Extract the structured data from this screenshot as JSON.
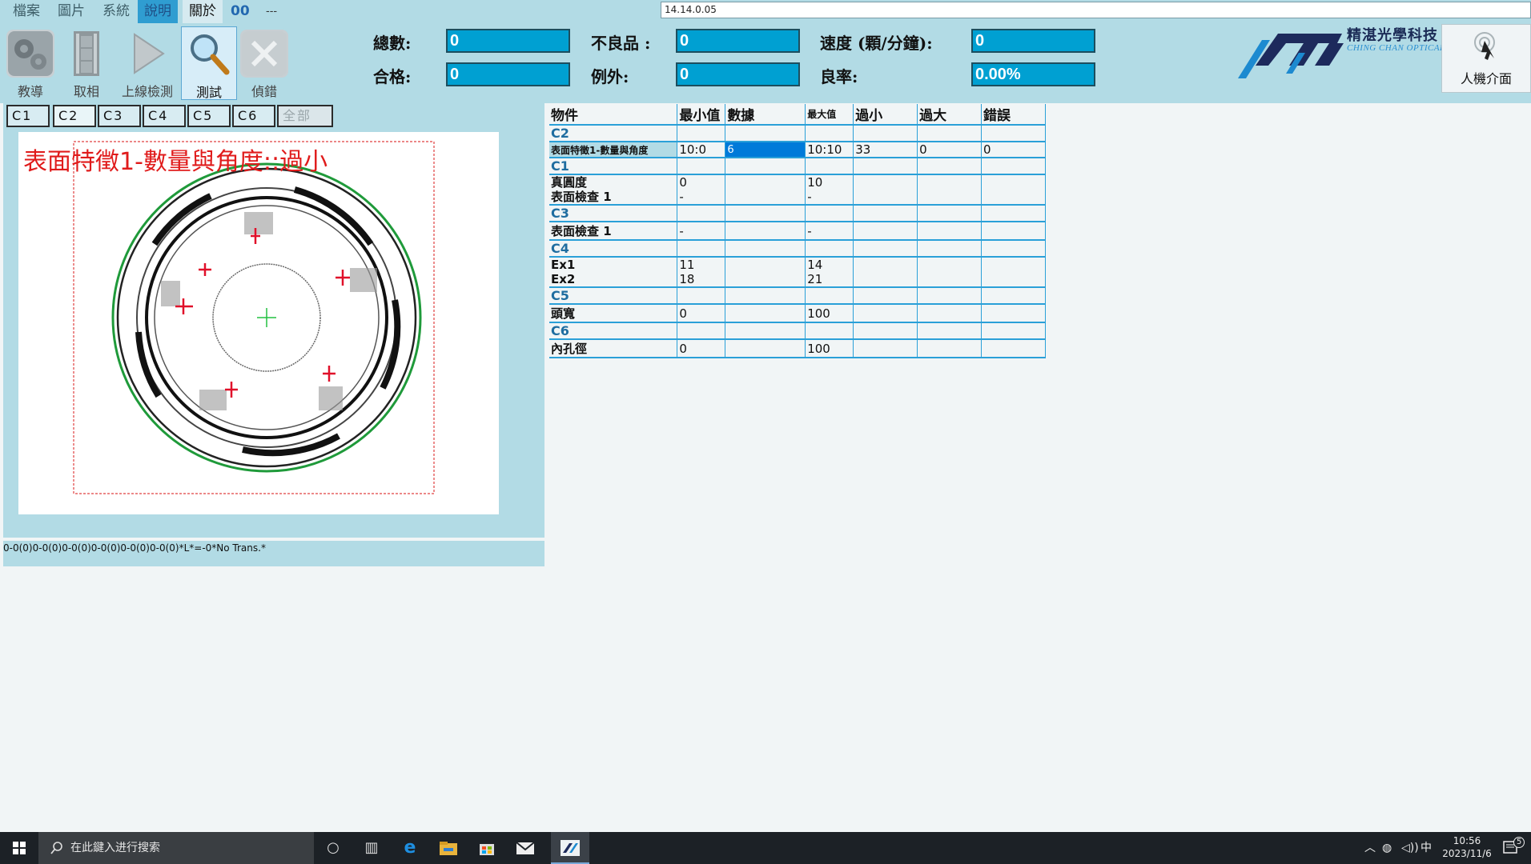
{
  "menu": {
    "items": [
      "檔案",
      "圖片",
      "系統",
      "說明",
      "關於"
    ],
    "counter": "00",
    "dash": "---",
    "version": "14.14.0.05"
  },
  "toolbar": {
    "tools": [
      {
        "label": "教導",
        "icon": "gears-icon"
      },
      {
        "label": "取相",
        "icon": "film-icon"
      },
      {
        "label": "上線檢測",
        "icon": "play-icon"
      },
      {
        "label": "測試",
        "icon": "magnifier-icon"
      },
      {
        "label": "偵錯",
        "icon": "tools-icon"
      }
    ],
    "selected_index": 3
  },
  "stats": {
    "total_label": "總數:",
    "total_value": "0",
    "pass_label": "合格:",
    "pass_value": "0",
    "defect_label": "不良品 :",
    "defect_value": "0",
    "exception_label": "例外:",
    "exception_value": "0",
    "speed_label": "速度 (顆/分鐘):",
    "speed_value": "0",
    "yield_label": "良率:",
    "yield_value": "0.00%"
  },
  "logo": {
    "cn": "精湛光學科技",
    "en": "CHING CHAN OPTICAL"
  },
  "hmi": {
    "label": "人機介面"
  },
  "camera_tabs": [
    "C1",
    "C2",
    "C3",
    "C4",
    "C5",
    "C6",
    "全部"
  ],
  "image_overlay": "表面特徵1-數量與角度::過小",
  "status_text": "0-0(0)0-0(0)0-0(0)0-0(0)0-0(0)0-0(0)*L*=-0*No Trans.*",
  "table": {
    "headers": [
      "物件",
      "最小值",
      "數據",
      "最大值",
      "過小",
      "過大",
      "錯誤"
    ],
    "groups": [
      {
        "name": "C2",
        "rows": [
          {
            "name": "表面特徵1-數量與角度",
            "min": "10:0",
            "data": "6",
            "max": "10:10",
            "under": "33",
            "over": "0",
            "error": "0"
          }
        ]
      },
      {
        "name": "C1",
        "rows": [
          {
            "name": "真圓度\n表面檢查 1",
            "min": "0\n-",
            "data": "",
            "max": "10\n-",
            "under": "",
            "over": "",
            "error": ""
          }
        ]
      },
      {
        "name": "C3",
        "rows": [
          {
            "name": "表面檢查 1",
            "min": "-",
            "data": "",
            "max": "-",
            "under": "",
            "over": "",
            "error": ""
          }
        ]
      },
      {
        "name": "C4",
        "rows": [
          {
            "name": "Ex1\nEx2",
            "min": "11\n18",
            "data": "",
            "max": "14\n21",
            "under": "",
            "over": "",
            "error": ""
          }
        ]
      },
      {
        "name": "C5",
        "rows": [
          {
            "name": "頭寬",
            "min": "0",
            "data": "",
            "max": "100",
            "under": "",
            "over": "",
            "error": ""
          }
        ]
      },
      {
        "name": "C6",
        "rows": [
          {
            "name": "內孔徑",
            "min": "0",
            "data": "",
            "max": "100",
            "under": "",
            "over": "",
            "error": ""
          }
        ]
      }
    ]
  },
  "taskbar": {
    "search_placeholder": "在此鍵入进行搜索",
    "ime": "中",
    "time": "10:56",
    "date": "2023/11/6",
    "notifications": "5"
  },
  "colors": {
    "panel": "#b2dbe5",
    "stat_box": "#00a0d2",
    "overlay_red": "#e01b1b",
    "table_line": "#2aa0d8",
    "selected_cell": "#007ad9"
  }
}
